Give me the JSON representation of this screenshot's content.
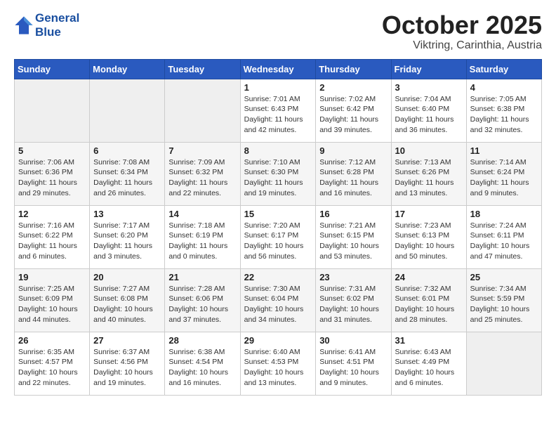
{
  "logo": {
    "line1": "General",
    "line2": "Blue"
  },
  "header": {
    "month": "October 2025",
    "location": "Viktring, Carinthia, Austria"
  },
  "weekdays": [
    "Sunday",
    "Monday",
    "Tuesday",
    "Wednesday",
    "Thursday",
    "Friday",
    "Saturday"
  ],
  "weeks": [
    [
      {
        "day": "",
        "info": ""
      },
      {
        "day": "",
        "info": ""
      },
      {
        "day": "",
        "info": ""
      },
      {
        "day": "1",
        "info": "Sunrise: 7:01 AM\nSunset: 6:43 PM\nDaylight: 11 hours and 42 minutes."
      },
      {
        "day": "2",
        "info": "Sunrise: 7:02 AM\nSunset: 6:42 PM\nDaylight: 11 hours and 39 minutes."
      },
      {
        "day": "3",
        "info": "Sunrise: 7:04 AM\nSunset: 6:40 PM\nDaylight: 11 hours and 36 minutes."
      },
      {
        "day": "4",
        "info": "Sunrise: 7:05 AM\nSunset: 6:38 PM\nDaylight: 11 hours and 32 minutes."
      }
    ],
    [
      {
        "day": "5",
        "info": "Sunrise: 7:06 AM\nSunset: 6:36 PM\nDaylight: 11 hours and 29 minutes."
      },
      {
        "day": "6",
        "info": "Sunrise: 7:08 AM\nSunset: 6:34 PM\nDaylight: 11 hours and 26 minutes."
      },
      {
        "day": "7",
        "info": "Sunrise: 7:09 AM\nSunset: 6:32 PM\nDaylight: 11 hours and 22 minutes."
      },
      {
        "day": "8",
        "info": "Sunrise: 7:10 AM\nSunset: 6:30 PM\nDaylight: 11 hours and 19 minutes."
      },
      {
        "day": "9",
        "info": "Sunrise: 7:12 AM\nSunset: 6:28 PM\nDaylight: 11 hours and 16 minutes."
      },
      {
        "day": "10",
        "info": "Sunrise: 7:13 AM\nSunset: 6:26 PM\nDaylight: 11 hours and 13 minutes."
      },
      {
        "day": "11",
        "info": "Sunrise: 7:14 AM\nSunset: 6:24 PM\nDaylight: 11 hours and 9 minutes."
      }
    ],
    [
      {
        "day": "12",
        "info": "Sunrise: 7:16 AM\nSunset: 6:22 PM\nDaylight: 11 hours and 6 minutes."
      },
      {
        "day": "13",
        "info": "Sunrise: 7:17 AM\nSunset: 6:20 PM\nDaylight: 11 hours and 3 minutes."
      },
      {
        "day": "14",
        "info": "Sunrise: 7:18 AM\nSunset: 6:19 PM\nDaylight: 11 hours and 0 minutes."
      },
      {
        "day": "15",
        "info": "Sunrise: 7:20 AM\nSunset: 6:17 PM\nDaylight: 10 hours and 56 minutes."
      },
      {
        "day": "16",
        "info": "Sunrise: 7:21 AM\nSunset: 6:15 PM\nDaylight: 10 hours and 53 minutes."
      },
      {
        "day": "17",
        "info": "Sunrise: 7:23 AM\nSunset: 6:13 PM\nDaylight: 10 hours and 50 minutes."
      },
      {
        "day": "18",
        "info": "Sunrise: 7:24 AM\nSunset: 6:11 PM\nDaylight: 10 hours and 47 minutes."
      }
    ],
    [
      {
        "day": "19",
        "info": "Sunrise: 7:25 AM\nSunset: 6:09 PM\nDaylight: 10 hours and 44 minutes."
      },
      {
        "day": "20",
        "info": "Sunrise: 7:27 AM\nSunset: 6:08 PM\nDaylight: 10 hours and 40 minutes."
      },
      {
        "day": "21",
        "info": "Sunrise: 7:28 AM\nSunset: 6:06 PM\nDaylight: 10 hours and 37 minutes."
      },
      {
        "day": "22",
        "info": "Sunrise: 7:30 AM\nSunset: 6:04 PM\nDaylight: 10 hours and 34 minutes."
      },
      {
        "day": "23",
        "info": "Sunrise: 7:31 AM\nSunset: 6:02 PM\nDaylight: 10 hours and 31 minutes."
      },
      {
        "day": "24",
        "info": "Sunrise: 7:32 AM\nSunset: 6:01 PM\nDaylight: 10 hours and 28 minutes."
      },
      {
        "day": "25",
        "info": "Sunrise: 7:34 AM\nSunset: 5:59 PM\nDaylight: 10 hours and 25 minutes."
      }
    ],
    [
      {
        "day": "26",
        "info": "Sunrise: 6:35 AM\nSunset: 4:57 PM\nDaylight: 10 hours and 22 minutes."
      },
      {
        "day": "27",
        "info": "Sunrise: 6:37 AM\nSunset: 4:56 PM\nDaylight: 10 hours and 19 minutes."
      },
      {
        "day": "28",
        "info": "Sunrise: 6:38 AM\nSunset: 4:54 PM\nDaylight: 10 hours and 16 minutes."
      },
      {
        "day": "29",
        "info": "Sunrise: 6:40 AM\nSunset: 4:53 PM\nDaylight: 10 hours and 13 minutes."
      },
      {
        "day": "30",
        "info": "Sunrise: 6:41 AM\nSunset: 4:51 PM\nDaylight: 10 hours and 9 minutes."
      },
      {
        "day": "31",
        "info": "Sunrise: 6:43 AM\nSunset: 4:49 PM\nDaylight: 10 hours and 6 minutes."
      },
      {
        "day": "",
        "info": ""
      }
    ]
  ]
}
